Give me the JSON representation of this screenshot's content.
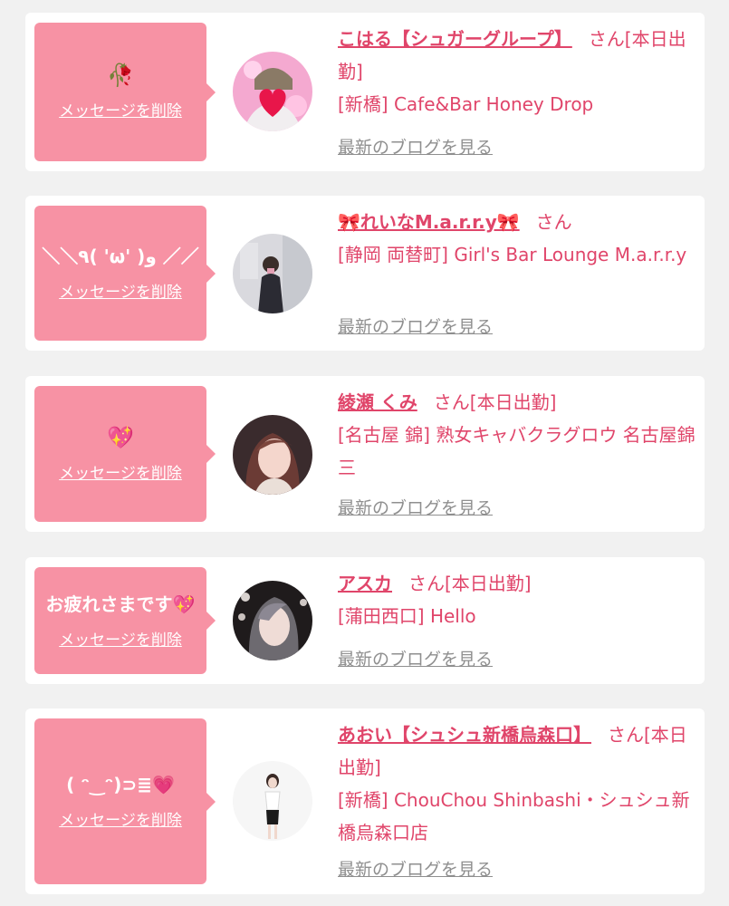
{
  "cards": [
    {
      "message": "🥀",
      "message_is_emoji": true,
      "delete_label": "メッセージを削除",
      "name": "こはる【シュガーグループ】",
      "suffix": "さん[本日出勤]",
      "shop": "[新橋] Cafe&Bar Honey Drop",
      "blog_label": "最新のブログを見る",
      "avatar_icon": "heart-face-photo"
    },
    {
      "message": "＼＼٩( 'ω' )و ／／",
      "message_is_emoji": false,
      "delete_label": "メッセージを削除",
      "name": "🎀れいなM.a.r.r.y🎀",
      "suffix": "さん",
      "shop": "[静岡 両替町] Girl's Bar Lounge M.a.r.r.y",
      "blog_label": "最新のブログを見る",
      "avatar_icon": "person-photo"
    },
    {
      "message": "💖",
      "message_is_emoji": true,
      "delete_label": "メッセージを削除",
      "name": "綾瀬 くみ",
      "suffix": "さん[本日出勤]",
      "shop": "[名古屋 錦] 熟女キャバクラグロウ 名古屋錦三",
      "blog_label": "最新のブログを見る",
      "avatar_icon": "person-photo"
    },
    {
      "message": "お疲れさまです💖",
      "message_is_emoji": false,
      "delete_label": "メッセージを削除",
      "name": "アスカ",
      "suffix": "さん[本日出勤]",
      "shop": "[蒲田西口] Hello",
      "blog_label": "最新のブログを見る",
      "avatar_icon": "person-photo"
    },
    {
      "message": "( ᵔ‿ᵔ)⊃≣💗",
      "message_is_emoji": false,
      "delete_label": "メッセージを削除",
      "name": "あおい【シュシュ新橋烏森口】",
      "suffix": "さん[本日出勤]",
      "shop": "[新橋] ChouChou Shinbashi・シュシュ新橋烏森口店",
      "blog_label": "最新のブログを見る",
      "avatar_icon": "person-photo"
    }
  ],
  "colors": {
    "accent": "#e0456a",
    "message_box": "#f792a4",
    "background": "#f1f1f1",
    "link_gray": "#8f8f8f"
  }
}
